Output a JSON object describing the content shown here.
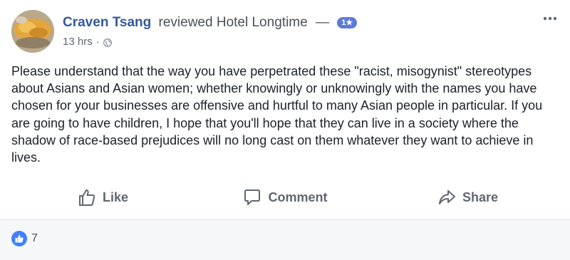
{
  "post": {
    "author": "Craven Tsang",
    "action": "reviewed",
    "page_name": "Hotel Longtime",
    "dash": "—",
    "rating_badge": "1★",
    "time": "13 hrs",
    "separator": "·",
    "audience_icon": "globe-icon",
    "more_icon": "more-options-icon",
    "body": "Please understand that the way you have perpetrated these \"racist, misogynist\" stereotypes about Asians and Asian women; whether knowingly or unknowingly with the names you have chosen for your businesses are offensive and hurtful to many Asian people in particular. If you are going to have children, I hope that you'll hope that they can live in a society where the shadow of race-based prejudices will no long cast on them whatever they want to achieve in lives."
  },
  "actions": {
    "like": {
      "label": "Like",
      "icon": "thumbs-up-icon"
    },
    "comment": {
      "label": "Comment",
      "icon": "comment-icon"
    },
    "share": {
      "label": "Share",
      "icon": "share-icon"
    }
  },
  "reactions": {
    "icon": "like-reaction-icon",
    "count": "7"
  },
  "colors": {
    "author_link": "#365899",
    "badge": "#5b7bd5",
    "like_reaction": "#4080ff",
    "action_text": "#606770",
    "footer_bg": "#f6f7f9"
  }
}
